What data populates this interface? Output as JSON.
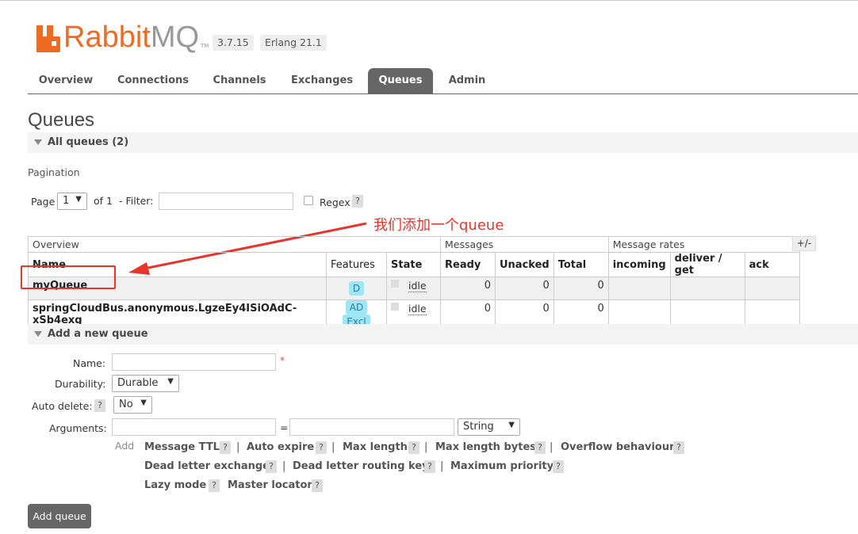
{
  "brand": {
    "name_orange": "Rabbit",
    "name_grey": "MQ",
    "tm": "TM"
  },
  "versions": {
    "rabbitmq": "3.7.15",
    "erlang": "Erlang 21.1"
  },
  "tabs": [
    {
      "label": "Overview"
    },
    {
      "label": "Connections"
    },
    {
      "label": "Channels"
    },
    {
      "label": "Exchanges"
    },
    {
      "label": "Queues",
      "active": true
    },
    {
      "label": "Admin"
    }
  ],
  "page": {
    "title": "Queues"
  },
  "all_queues": {
    "label": "All queues (2)"
  },
  "pagination": {
    "section_label": "Pagination",
    "page_label": "Page",
    "page_value": "1",
    "of_label": "of 1",
    "filter_label": "- Filter:",
    "filter_value": "",
    "regex_label": "Regex",
    "help": "?"
  },
  "annotation": {
    "text": "我们添加一个queue",
    "color": "#e8352b"
  },
  "table": {
    "groups": {
      "overview": "Overview",
      "messages": "Messages",
      "rates": "Message rates"
    },
    "plusminus": "+/-",
    "columns": [
      "Name",
      "Features",
      "State",
      "Ready",
      "Unacked",
      "Total",
      "incoming",
      "deliver / get",
      "ack"
    ],
    "rows": [
      {
        "name": "myQueue",
        "features": [
          "D"
        ],
        "state": "idle",
        "ready": "0",
        "unacked": "0",
        "total": "0"
      },
      {
        "name": "springCloudBus.anonymous.LgzeEy4ISiOAdC-xSb4exg",
        "features": [
          "AD",
          "Excl"
        ],
        "state": "idle",
        "ready": "0",
        "unacked": "0",
        "total": "0"
      }
    ]
  },
  "add_queue": {
    "section_label": "Add a new queue",
    "name_label": "Name:",
    "name_value": "",
    "required_mark": "*",
    "durability_label": "Durability:",
    "durability_value": "Durable",
    "auto_delete_label": "Auto delete:",
    "auto_delete_value": "No",
    "arguments_label": "Arguments:",
    "equals": "=",
    "arg_type_value": "String",
    "add_label": "Add",
    "options": {
      "message_ttl": "Message TTL",
      "auto_expire": "Auto expire",
      "max_length": "Max length",
      "max_length_bytes": "Max length bytes",
      "overflow": "Overflow behaviour",
      "dlx": "Dead letter exchange",
      "dlrk": "Dead letter routing key",
      "max_priority": "Maximum priority",
      "lazy_mode": "Lazy mode",
      "master_locator": "Master locator"
    },
    "pipe": "|",
    "help": "?",
    "submit_label": "Add queue"
  }
}
